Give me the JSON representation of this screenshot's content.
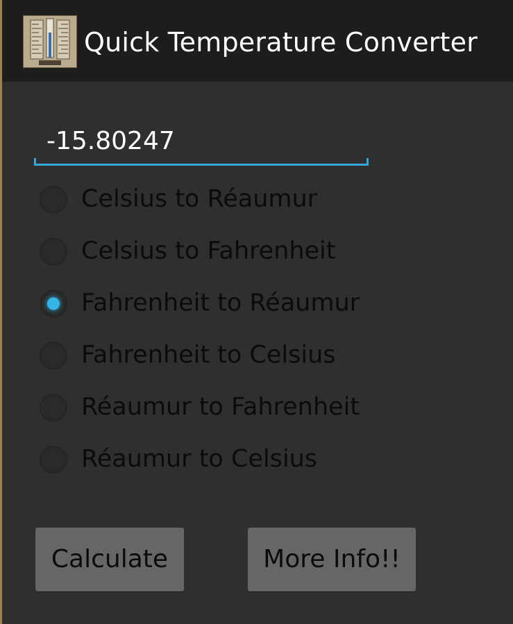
{
  "app": {
    "title": "Quick Temperature Converter",
    "icon": "thermometer-app-icon"
  },
  "input": {
    "value": "-15.80247",
    "placeholder": ""
  },
  "options": [
    {
      "label": "Celsius to Réaumur",
      "selected": false
    },
    {
      "label": "Celsius to Fahrenheit",
      "selected": false
    },
    {
      "label": "Fahrenheit to Réaumur",
      "selected": true
    },
    {
      "label": "Fahrenheit to Celsius",
      "selected": false
    },
    {
      "label": "Réaumur to Fahrenheit",
      "selected": false
    },
    {
      "label": "Réaumur to Celsius",
      "selected": false
    }
  ],
  "buttons": {
    "calculate": "Calculate",
    "more_info": "More Info!!"
  },
  "colors": {
    "accent": "#33b5e5",
    "action_bar": "#1d1d1d",
    "background": "#2f2f2f",
    "button": "#666666"
  }
}
